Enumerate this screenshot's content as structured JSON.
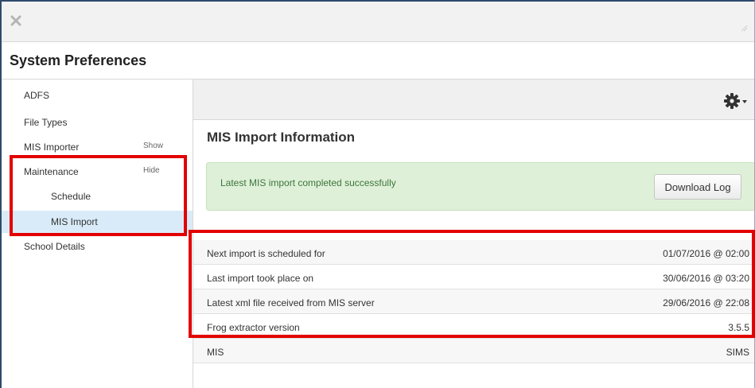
{
  "window": {
    "title": "System Preferences"
  },
  "sidebar": {
    "items": [
      {
        "label": "ADFS"
      },
      {
        "label": "File Types"
      },
      {
        "label": "MIS Importer",
        "toggle": "Show"
      },
      {
        "label": "Maintenance",
        "toggle": "Hide"
      },
      {
        "label": "Schedule"
      },
      {
        "label": "MIS Import",
        "active": true
      },
      {
        "label": "School Details"
      }
    ]
  },
  "main": {
    "section_title": "MIS Import Information",
    "alert": {
      "message": "Latest MIS import completed successfully",
      "button_label": "Download Log"
    },
    "info_rows": [
      {
        "label": "Next import is scheduled for",
        "value": "01/07/2016 @ 02:00"
      },
      {
        "label": "Last import took place on",
        "value": "30/06/2016 @ 03:20"
      },
      {
        "label": "Latest xml file received from MIS server",
        "value": "29/06/2016 @ 22:08"
      },
      {
        "label": "Frog extractor version",
        "value": "3.5.5"
      },
      {
        "label": "MIS",
        "value": "SIMS"
      }
    ]
  },
  "colors": {
    "highlight": "#e30000",
    "alert_bg": "#dff0d8",
    "alert_text": "#3c763d",
    "active_nav": "#d9ebf8"
  },
  "icons": {
    "close": "close-icon",
    "resize": "resize-grip-icon",
    "settings": "gear-icon",
    "dropdown": "caret-down-icon"
  }
}
